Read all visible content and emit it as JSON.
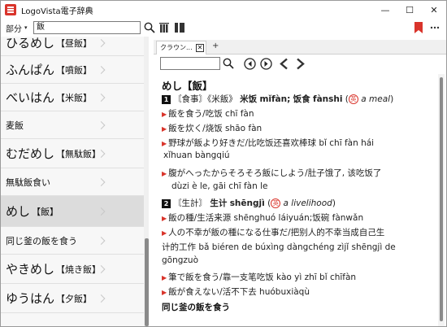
{
  "window": {
    "title": "LogoVista電子辞典",
    "controls": {
      "minimize": "—",
      "maximize": "☐",
      "close": "✕"
    }
  },
  "toolbar": {
    "dict_label": "部分",
    "dict_arrow": "▾",
    "search_value": "飯",
    "bookmark_color": "#d9342b"
  },
  "list": {
    "items": [
      {
        "main": "ひるめし",
        "kanji": "【昼飯】",
        "selected": false
      },
      {
        "main": "ふんぱん",
        "kanji": "【噴飯】",
        "selected": false
      },
      {
        "main": "べいはん",
        "kanji": "【米飯】",
        "selected": false
      },
      {
        "main": "麦飯",
        "kanji": "",
        "selected": false
      },
      {
        "main": "むだめし",
        "kanji": "【無駄飯】",
        "selected": false
      },
      {
        "main": "無駄飯食い",
        "kanji": "",
        "selected": false
      },
      {
        "main": "めし",
        "kanji": "【飯】",
        "selected": true
      },
      {
        "main": "同じ釜の飯を食う",
        "kanji": "",
        "selected": false
      },
      {
        "main": "やきめし",
        "kanji": "【焼き飯】",
        "selected": false
      },
      {
        "main": "ゆうはん",
        "kanji": "【夕飯】",
        "selected": false
      }
    ]
  },
  "tabs": {
    "active_label": "クラウン...",
    "close_label": "✕",
    "add_label": "+"
  },
  "entry": {
    "headword": "めし【飯】",
    "sense1_num": "1",
    "sense1_tag": "〘食事〙",
    "sense1_alt": "《米飯》",
    "sense1_cn": "米饭",
    "sense1_py": "mǐfàn",
    "sense1_sep": ";",
    "sense1_cn2": "饭食",
    "sense1_py2": "fànshi",
    "sense1_paren_open": "(",
    "sense1_circle": "英",
    "sense1_en": "a meal",
    "sense1_paren_close": ")",
    "ex1_jp": "飯を食う",
    "ex1_cn": "/吃饭",
    "ex1_py": "chī fàn",
    "ex2_jp": "飯を炊く",
    "ex2_cn": "/烧饭",
    "ex2_py": "shāo fàn",
    "ex3_jp": "野球が飯より好きだ",
    "ex3_cn": "/比吃饭还喜欢棒球",
    "ex3_py": "bǐ chī fàn hái",
    "ex3_py2": "xǐhuan bàngqiú",
    "ex4_jp": "腹がへったからそろそろ飯にしよう",
    "ex4_cn": "/肚子饿了, 该吃饭了",
    "ex4_py": "dùzi è le, gāi chī fàn le",
    "sense2_num": "2",
    "sense2_tag": "〘生計〙",
    "sense2_cn": "生计",
    "sense2_py": "shēngjì",
    "sense2_paren_open": "(",
    "sense2_circle": "英",
    "sense2_en": "a livelihood",
    "sense2_paren_close": ")",
    "ex5_jp": "飯の種",
    "ex5_cn": "/生活来源",
    "ex5_py": "shēnghuó láiyuán;",
    "ex5_cn2": "饭碗",
    "ex5_py2": "fànwǎn",
    "ex6_jp": "人の不幸が飯の種になる仕事だ",
    "ex6_cn": "/把别人的不幸当成自己生",
    "ex6_cn2": "计的工作",
    "ex6_py": "bǎ biéren de búxìng dàngchéng zìjǐ shēngjì de",
    "ex6_py2": "gōngzuò",
    "ex7_jp": "筆で飯を食う",
    "ex7_cn": "/靠一支笔吃饭",
    "ex7_py": "kào yì zhī bǐ chīfàn",
    "ex8_jp": "飯が食えない",
    "ex8_cn": "/活不下去",
    "ex8_py": "huóbuxiàqù",
    "sub_headword": "同じ釜の飯を食う"
  }
}
